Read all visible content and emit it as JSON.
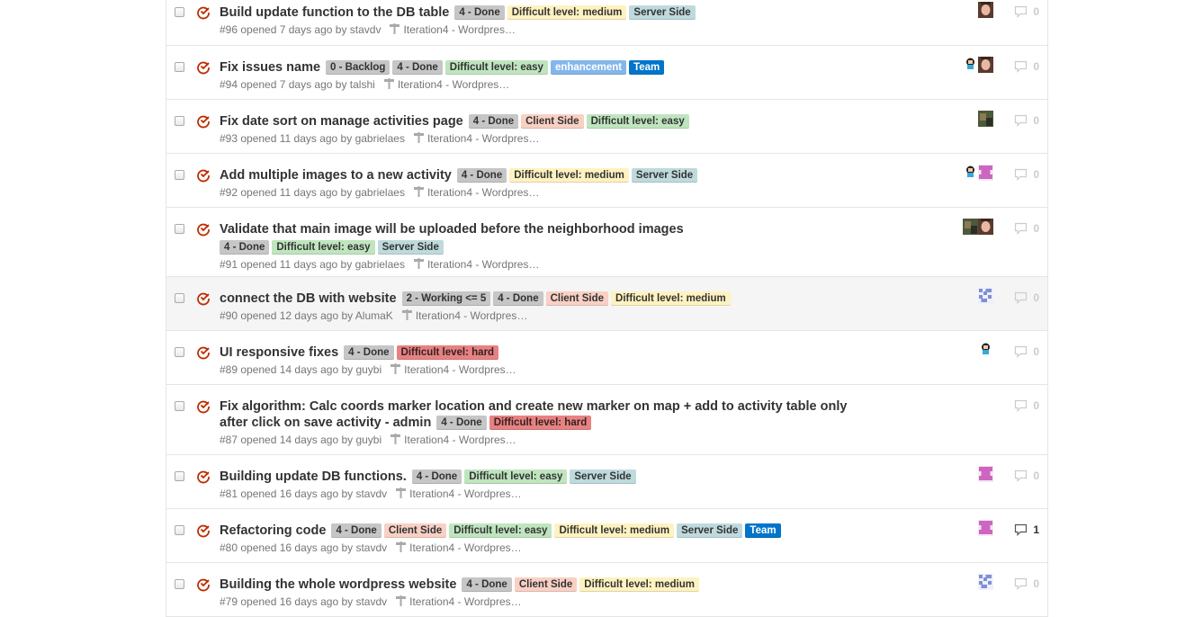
{
  "colors": {
    "done": "#c6c6c6",
    "backlog": "#c6c6c6",
    "working": "#c6c6c6",
    "medium": "#fef2c0",
    "easy": "#bfe5bf",
    "hard": "#e88181",
    "server": "#bfdadc",
    "client": "#f9d0c4",
    "enhancement": "#84b6eb",
    "team": "#0075ca",
    "open_icon": "#bd2c00"
  },
  "issues": [
    {
      "title": "Build update function to the DB table",
      "labels": [
        {
          "text": "4 - Done",
          "kind": "done"
        },
        {
          "text": "Difficult level: medium",
          "kind": "medium"
        },
        {
          "text": "Server Side",
          "kind": "server"
        }
      ],
      "meta": "#96 opened 7 days ago by stavdv",
      "milestone": "Iteration4 - Wordpres…",
      "avatars": [
        "face"
      ],
      "comments": "0"
    },
    {
      "title": "Fix issues name",
      "labels": [
        {
          "text": "0 - Backlog",
          "kind": "backlog"
        },
        {
          "text": "4 - Done",
          "kind": "done"
        },
        {
          "text": "Difficult level: easy",
          "kind": "easy"
        },
        {
          "text": "enhancement",
          "kind": "enhancement"
        },
        {
          "text": "Team",
          "kind": "team"
        }
      ],
      "meta": "#94 opened 7 days ago by talshi",
      "milestone": "Iteration4 - Wordpres…",
      "avatars": [
        "octo",
        "face"
      ],
      "comments": "0"
    },
    {
      "title": "Fix date sort on manage activities page",
      "labels": [
        {
          "text": "4 - Done",
          "kind": "done"
        },
        {
          "text": "Client Side",
          "kind": "client"
        },
        {
          "text": "Difficult level: easy",
          "kind": "easy"
        }
      ],
      "meta": "#93 opened 11 days ago by gabrielaes",
      "milestone": "Iteration4 - Wordpres…",
      "avatars": [
        "photo"
      ],
      "comments": "0"
    },
    {
      "title": "Add multiple images to a new activity",
      "labels": [
        {
          "text": "4 - Done",
          "kind": "done"
        },
        {
          "text": "Difficult level: medium",
          "kind": "medium"
        },
        {
          "text": "Server Side",
          "kind": "server"
        }
      ],
      "meta": "#92 opened 11 days ago by gabrielaes",
      "milestone": "Iteration4 - Wordpres…",
      "avatars": [
        "octo",
        "pink"
      ],
      "comments": "0"
    },
    {
      "title": "Validate that main image will be uploaded before the neighborhood images",
      "labels": [
        {
          "text": "4 - Done",
          "kind": "done"
        },
        {
          "text": "Difficult level: easy",
          "kind": "easy"
        },
        {
          "text": "Server Side",
          "kind": "server"
        }
      ],
      "meta": "#91 opened 11 days ago by gabrielaes",
      "milestone": "Iteration4 - Wordpres…",
      "avatars": [
        "photo",
        "face"
      ],
      "comments": "0"
    },
    {
      "title": "connect the DB with website",
      "labels": [
        {
          "text": "2 - Working <= 5",
          "kind": "working"
        },
        {
          "text": "4 - Done",
          "kind": "done"
        },
        {
          "text": "Client Side",
          "kind": "client"
        },
        {
          "text": "Difficult level: medium",
          "kind": "medium"
        }
      ],
      "meta": "#90 opened 12 days ago by AlumaK",
      "milestone": "Iteration4 - Wordpres…",
      "avatars": [
        "blue"
      ],
      "comments": "0"
    },
    {
      "title": "UI responsive fixes",
      "labels": [
        {
          "text": "4 - Done",
          "kind": "done"
        },
        {
          "text": "Difficult level: hard",
          "kind": "hard"
        }
      ],
      "meta": "#89 opened 14 days ago by guybi",
      "milestone": "Iteration4 - Wordpres…",
      "avatars": [
        "octo"
      ],
      "comments": "0"
    },
    {
      "title": "Fix algorithm: Calc coords marker location and create new marker on map + add to activity table only after click on save activity - admin",
      "labels": [
        {
          "text": "4 - Done",
          "kind": "done"
        },
        {
          "text": "Difficult level: hard",
          "kind": "hard"
        }
      ],
      "meta": "#87 opened 14 days ago by guybi",
      "milestone": "Iteration4 - Wordpres…",
      "avatars": [],
      "comments": "0"
    },
    {
      "title": "Building update DB functions.",
      "labels": [
        {
          "text": "4 - Done",
          "kind": "done"
        },
        {
          "text": "Difficult level: easy",
          "kind": "easy"
        },
        {
          "text": "Server Side",
          "kind": "server"
        }
      ],
      "meta": "#81 opened 16 days ago by stavdv",
      "milestone": "Iteration4 - Wordpres…",
      "avatars": [
        "pink"
      ],
      "comments": "0"
    },
    {
      "title": "Refactoring code",
      "labels": [
        {
          "text": "4 - Done",
          "kind": "done"
        },
        {
          "text": "Client Side",
          "kind": "client"
        },
        {
          "text": "Difficult level: easy",
          "kind": "easy"
        },
        {
          "text": "Difficult level: medium",
          "kind": "medium"
        },
        {
          "text": "Server Side",
          "kind": "server"
        },
        {
          "text": "Team",
          "kind": "team"
        }
      ],
      "meta": "#80 opened 16 days ago by stavdv",
      "milestone": "Iteration4 - Wordpres…",
      "avatars": [
        "pink"
      ],
      "comments": "1"
    },
    {
      "title": "Building the whole wordpress website",
      "labels": [
        {
          "text": "4 - Done",
          "kind": "done"
        },
        {
          "text": "Client Side",
          "kind": "client"
        },
        {
          "text": "Difficult level: medium",
          "kind": "medium"
        }
      ],
      "meta": "#79 opened 16 days ago by stavdv",
      "milestone": "Iteration4 - Wordpres…",
      "avatars": [
        "blue"
      ],
      "comments": "0"
    }
  ]
}
